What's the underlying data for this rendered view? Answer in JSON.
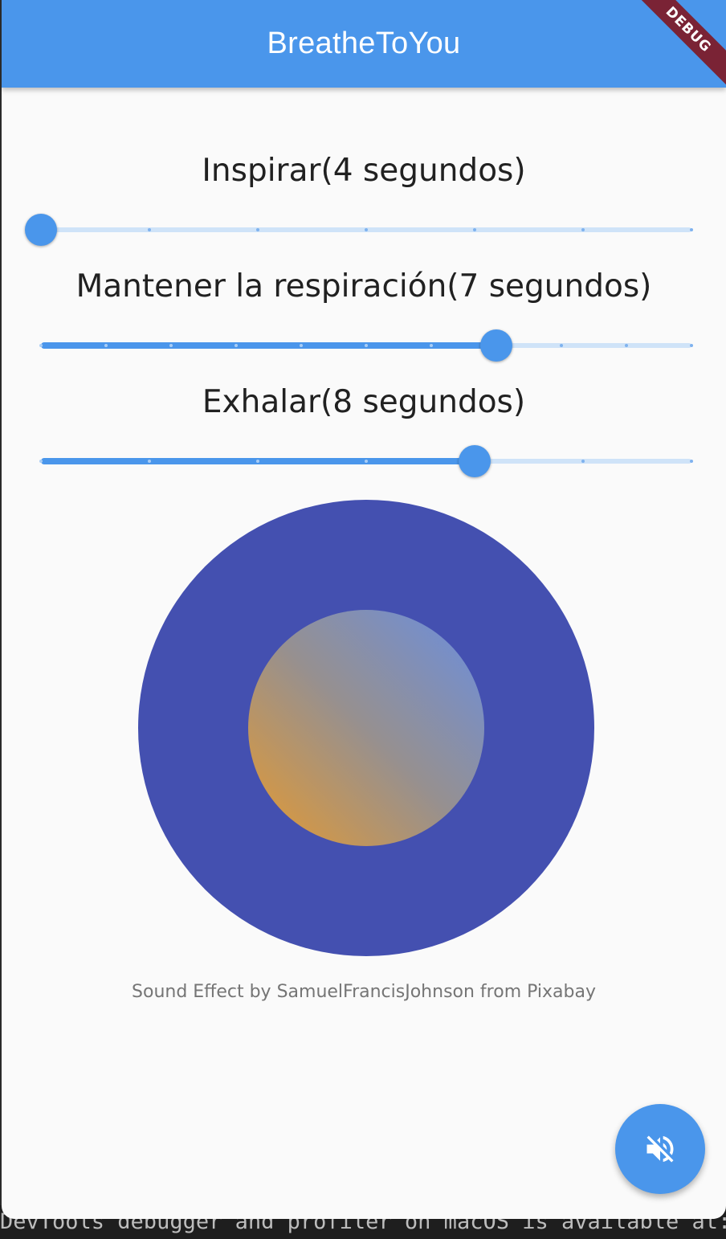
{
  "app_bar": {
    "title": "BreatheToYou",
    "debug_label": "DEBUG"
  },
  "sliders": [
    {
      "label": "Inspirar(4 segundos)",
      "value": 4,
      "min": 4,
      "max": 10,
      "divisions": 6
    },
    {
      "label": "Mantener la respiración(7 segundos)",
      "value": 7,
      "min": 0,
      "max": 10,
      "divisions": 10
    },
    {
      "label": "Exhalar(8 segundos)",
      "value": 8,
      "min": 4,
      "max": 10,
      "divisions": 6
    }
  ],
  "credit": "Sound Effect by SamuelFrancisJohnson from Pixabay",
  "fab": {
    "icon": "volume-off-icon"
  },
  "terminal": {
    "text": "DevTools debugger and profiler on macOS is available at: ",
    "link": "ht"
  },
  "colors": {
    "primary": "#4a96eb",
    "outer_circle": "#4450b0",
    "gradient_start": "#e59a30",
    "gradient_end": "#6a8ee0"
  }
}
